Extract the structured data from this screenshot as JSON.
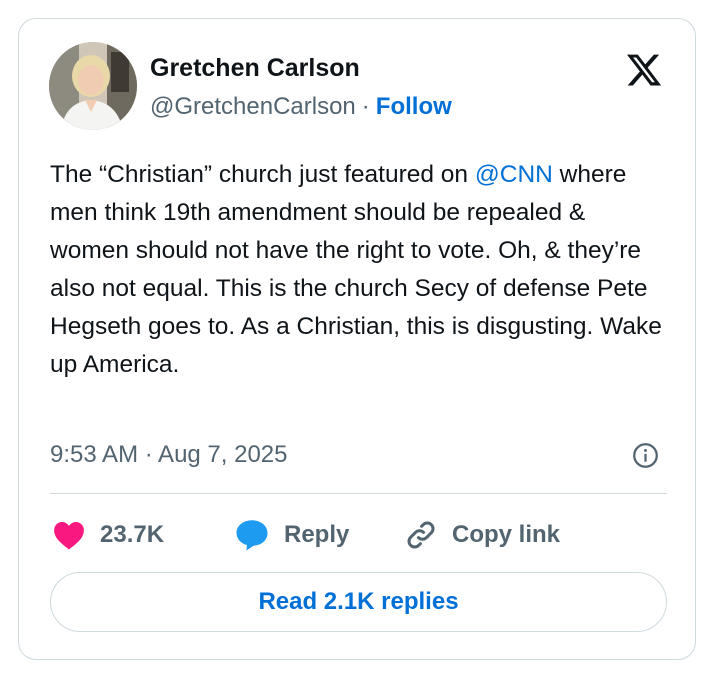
{
  "author": {
    "name": "Gretchen Carlson",
    "handle": "@GretchenCarlson",
    "separator": "·",
    "follow_label": "Follow"
  },
  "platform_logo": "x-logo-icon",
  "tweet": {
    "text_before_mention": "The “Christian” church just featured on ",
    "mention": "@CNN",
    "text_after_mention": " where men think 19th amendment should be repealed & women should not have the right to vote. Oh, & they’re also not equal. This is the church Secy of defense Pete Hegseth goes to. As a Christian, this is disgusting. Wake up America."
  },
  "timestamp": "9:53 AM · Aug 7, 2025",
  "actions": {
    "like_count": "23.7K",
    "reply_label": "Reply",
    "copy_link_label": "Copy link"
  },
  "read_replies_label": "Read 2.1K replies",
  "colors": {
    "link_blue": "#006fd6",
    "like_pink": "#f91880",
    "reply_blue": "#1d9bf0",
    "secondary_text": "#536471",
    "primary_text": "#0f1419",
    "border": "#cfd9de"
  }
}
